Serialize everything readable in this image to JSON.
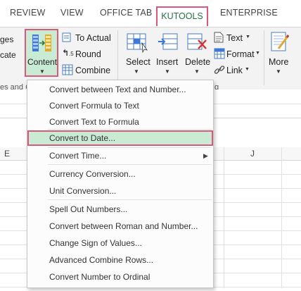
{
  "tabs": [
    {
      "label": "REVIEW",
      "active": false
    },
    {
      "label": "VIEW",
      "active": false
    },
    {
      "label": "OFFICE TAB",
      "active": false
    },
    {
      "label": "KUTOOLS",
      "active": true
    },
    {
      "label": "ENTERPRISE",
      "active": false
    }
  ],
  "ribbon": {
    "left_partial_1": "ges",
    "left_partial_2": "cate",
    "content_label": "Content",
    "to_actual_label": "To Actual",
    "round_label": "Round",
    "combine_label": "Combine",
    "select_label": "Select",
    "insert_label": "Insert",
    "delete_label": "Delete",
    "text_label": "Text",
    "format_label": "Format",
    "link_label": "Link",
    "more_label": "More",
    "group_left_partial": "es and C",
    "group_right_partial": "g"
  },
  "sheet": {
    "columns": [
      "E",
      "J"
    ]
  },
  "menu": {
    "items": [
      {
        "label": "Convert between Text and Number...",
        "highlighted": false,
        "submenu": false
      },
      {
        "label": "Convert Formula to Text",
        "highlighted": false,
        "submenu": false
      },
      {
        "label": "Convert Text to Formula",
        "highlighted": false,
        "submenu": false
      },
      {
        "label": "Convert to Date...",
        "highlighted": true,
        "submenu": false
      },
      {
        "label": "Convert Time...",
        "highlighted": false,
        "submenu": true
      },
      {
        "label": "Currency Conversion...",
        "highlighted": false,
        "submenu": false
      },
      {
        "label": "Unit Conversion...",
        "highlighted": false,
        "submenu": false
      },
      {
        "label": "Spell Out Numbers...",
        "highlighted": false,
        "submenu": false
      },
      {
        "label": "Convert between Roman and Number...",
        "highlighted": false,
        "submenu": false
      },
      {
        "label": "Change Sign of Values...",
        "highlighted": false,
        "submenu": false
      },
      {
        "label": "Advanced Combine Rows...",
        "highlighted": false,
        "submenu": false
      },
      {
        "label": "Convert Number to Ordinal",
        "highlighted": false,
        "submenu": false
      }
    ]
  },
  "colors": {
    "highlight_border": "#d9597a",
    "highlight_fill": "#c9ebd4",
    "excel_green": "#217346"
  }
}
